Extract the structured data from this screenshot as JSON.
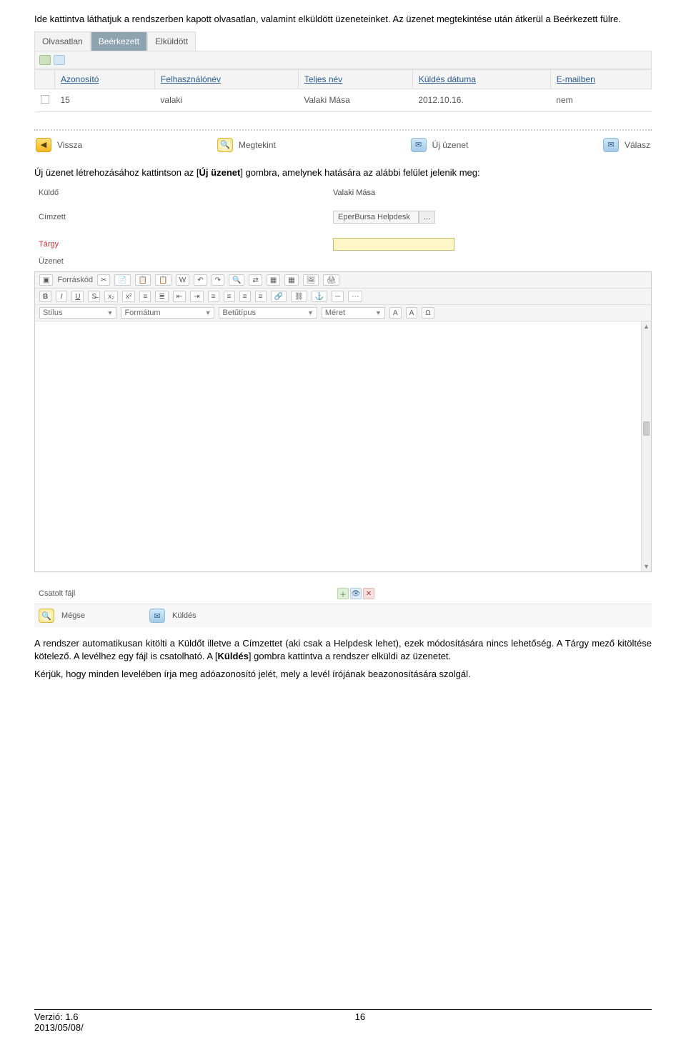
{
  "para1": "Ide kattintva láthatjuk a rendszerben kapott olvasatlan, valamint elküldött üzeneteinket. Az üzenet megtekintése után átkerül a Beérkezett fülre.",
  "tabs": [
    "Olvasatlan",
    "Beérkezett",
    "Elküldött"
  ],
  "grid": {
    "headers": [
      "Azonosító",
      "Felhasználónév",
      "Teljes név",
      "Küldés dátuma",
      "E-mailben"
    ],
    "row": {
      "id": "15",
      "user": "valaki",
      "name": "Valaki Mása",
      "date": "2012.10.16.",
      "email": "nem"
    }
  },
  "actions": {
    "back": "Vissza",
    "view": "Megtekint",
    "new": "Új üzenet",
    "reply": "Válasz"
  },
  "para2_a": "Új üzenet létrehozásához kattintson az [",
  "para2_b": "Új üzenet",
  "para2_c": "] gombra, amelynek hatására az alábbi felület jelenik meg:",
  "form": {
    "sender_label": "Küldő",
    "sender_value": "Valaki Mása",
    "recipient_label": "Címzett",
    "recipient_value": "EperBursa Helpdesk",
    "recipient_btn": "...",
    "subject_label": "Tárgy",
    "body_label": "Üzenet"
  },
  "toolbar": {
    "source": "Forráskód",
    "style": "Stílus",
    "format": "Formátum",
    "font": "Betűtípus",
    "size": "Méret"
  },
  "attach_label": "Csatolt fájl",
  "send": {
    "cancel": "Mégse",
    "send": "Küldés"
  },
  "para3_a": "A rendszer automatikusan kitölti a Küldőt illetve a Címzettet (aki csak a Helpdesk lehet), ezek módosítására nincs lehetőség. A Tárgy mező kitöltése kötelező. A levélhez egy fájl is csatolható. A [",
  "para3_b": "Küldés",
  "para3_c": "] gombra kattintva a rendszer elküldi az üzenetet.",
  "para4": "Kérjük, hogy minden levelében írja meg adóazonosító jelét, mely a levél írójának beazonosítására szolgál.",
  "footer": {
    "version": "Verzió: 1.6",
    "date": "2013/05/08/",
    "page": "16"
  }
}
